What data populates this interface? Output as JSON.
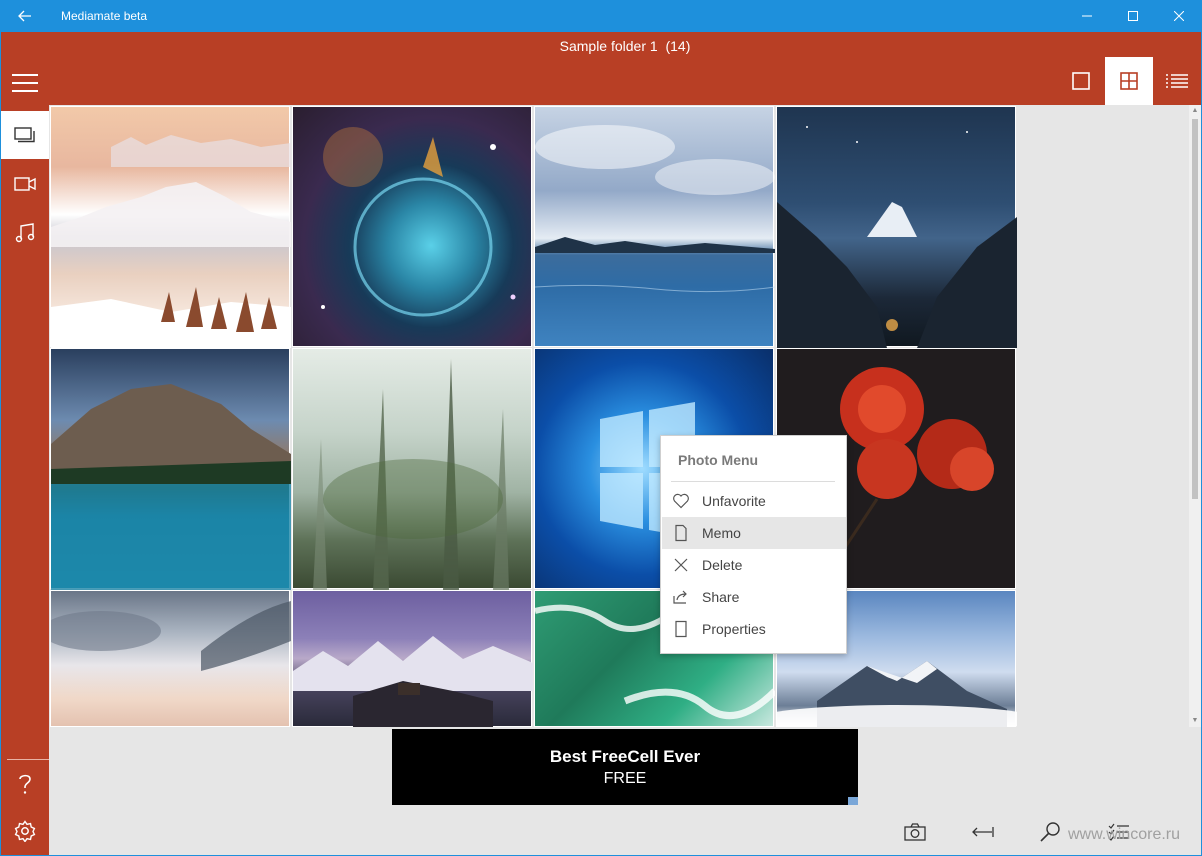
{
  "window": {
    "title": "Mediamate beta"
  },
  "header": {
    "folder_name": "Sample folder 1",
    "folder_count": "(14)"
  },
  "sidebar": {
    "items": [
      {
        "name": "menu",
        "icon": "hamburger-icon"
      },
      {
        "name": "photos",
        "icon": "photos-icon",
        "active": true
      },
      {
        "name": "videos",
        "icon": "video-icon"
      },
      {
        "name": "music",
        "icon": "music-icon"
      },
      {
        "name": "help",
        "icon": "help-icon"
      },
      {
        "name": "settings",
        "icon": "gear-icon"
      }
    ]
  },
  "view_modes": [
    {
      "name": "single",
      "icon": "single-view-icon"
    },
    {
      "name": "grid",
      "icon": "grid-view-icon",
      "active": true
    },
    {
      "name": "list",
      "icon": "list-view-icon"
    }
  ],
  "context_menu": {
    "title": "Photo Menu",
    "items": [
      {
        "label": "Unfavorite",
        "icon": "heart-icon"
      },
      {
        "label": "Memo",
        "icon": "page-icon",
        "highlighted": true
      },
      {
        "label": "Delete",
        "icon": "close-icon"
      },
      {
        "label": "Share",
        "icon": "share-icon"
      },
      {
        "label": "Properties",
        "icon": "page-icon"
      }
    ]
  },
  "ad": {
    "title": "Best FreeCell Ever",
    "subtitle": "FREE"
  },
  "bottom_toolbar": [
    {
      "name": "camera",
      "icon": "camera-icon"
    },
    {
      "name": "back",
      "icon": "arrow-left-bar-icon"
    },
    {
      "name": "search",
      "icon": "search-icon"
    },
    {
      "name": "select",
      "icon": "checklist-icon"
    }
  ],
  "watermark": "www.wincore.ru",
  "colors": {
    "accent": "#b83f25",
    "titlebar": "#1e90dc"
  },
  "photos": [
    {
      "name": "snowy-mountains-sunrise"
    },
    {
      "name": "bubble-nebula"
    },
    {
      "name": "lake-under-clouds"
    },
    {
      "name": "matterhorn-night"
    },
    {
      "name": "mountain-lake-blue"
    },
    {
      "name": "misty-forest"
    },
    {
      "name": "windows-logo-wallpaper"
    },
    {
      "name": "red-roses"
    },
    {
      "name": "sunset-clouds"
    },
    {
      "name": "purple-mountain-range"
    },
    {
      "name": "ocean-waves-aerial"
    },
    {
      "name": "peaks-above-clouds"
    }
  ]
}
